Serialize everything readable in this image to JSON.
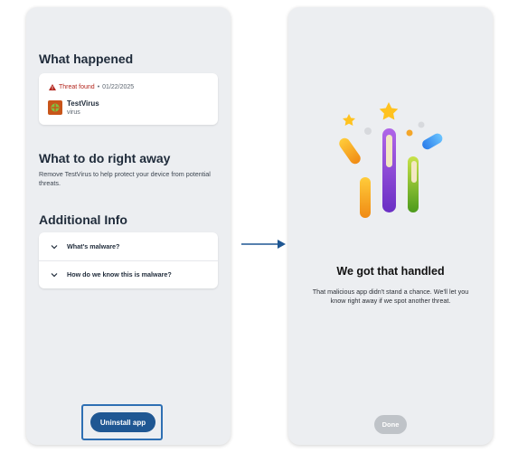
{
  "left_screen": {
    "what_happened": {
      "title": "What happened",
      "threat_status": "Threat found",
      "separator": "•",
      "threat_date": "01/22/2025",
      "app_name": "TestVirus",
      "app_type": "virus"
    },
    "what_to_do": {
      "title": "What to do right away",
      "description": "Remove TestVirus to help protect your device from potential threats."
    },
    "additional_info": {
      "title": "Additional Info",
      "items": [
        {
          "label": "What's malware?"
        },
        {
          "label": "How do we know this is malware?"
        }
      ]
    },
    "uninstall_label": "Uninstall app"
  },
  "right_screen": {
    "title": "We got that handled",
    "description": "That malicious app didn't stand a chance. We'll let you know right away if we spot another threat.",
    "done_label": "Done"
  },
  "colors": {
    "screen_bg": "#eceef1",
    "primary_button": "#1f5793",
    "highlight_frame": "#2e6fb3",
    "threat_red": "#b3261e",
    "done_disabled": "#bfc3c8"
  },
  "icons": [
    "warning-triangle-icon",
    "virus-app-icon",
    "chevron-down-icon",
    "arrow-right-icon",
    "celebration-illustration"
  ]
}
